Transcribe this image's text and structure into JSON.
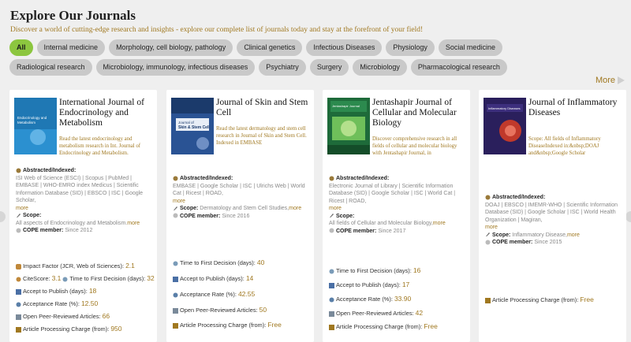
{
  "header": {
    "title": "Explore Our Journals",
    "subtitle": "Discover a world of cutting-edge research and insights - explore our complete list of journals today and stay at the forefront of your field!"
  },
  "filters": [
    "All",
    "Internal medicine",
    "Morphology, cell biology, pathology",
    "Clinical genetics",
    "Infectious Diseases",
    "Physiology",
    "Social medicine",
    "Radiological research",
    "Microbiology, immunology, infectious diseases",
    "Psychiatry",
    "Surgery",
    "Microbiology",
    "Pharmacological research"
  ],
  "more_label": "More",
  "cards": [
    {
      "title": "International Journal of Endocrinology and Metabolism",
      "cover_text": "International Journal of Endocrinology and Metabolism",
      "description": "Read the latest endocrinology and metabolism research in Int. Journal of Endocrinology and Metabolism.",
      "abstracted_label": "Abstracted/Indexed:",
      "abstracted": "ISI Web of Science (ESCI) | Scopus | PubMed | EMBASE | WHO-EMRO index Medicus | Scientific Information Database (SID) | EBSCO | ISC | Google Scholar,",
      "more": "more",
      "scope_label": "Scope:",
      "scope": "All aspects of Endocrinology and Metabolism.",
      "scope_more": "more",
      "cope_label": "COPE member:",
      "cope": "Since 2012",
      "metrics": [
        {
          "label": "Impact Factor (JCR, Web of Sciences):",
          "value": "2.1"
        },
        {
          "label": "CiteScore:",
          "value": "3.1",
          "label2": "Time to First Decision (days):",
          "value2": "32"
        },
        {
          "label": "Accept to Publish (days):",
          "value": "18"
        },
        {
          "label": "Acceptance Rate (%):",
          "value": "12.50"
        },
        {
          "label": "Open Peer-Reviewed Articles:",
          "value": "66"
        },
        {
          "label": "Article Processing Charge (from):",
          "value": "950"
        }
      ]
    },
    {
      "title": "Journal of Skin and Stem Cell",
      "cover_text": "Journal of Skin & Stem Cell",
      "description": "Read the latest dermatology and stem cell research in Journal of Skin and Stem Cell. Indexed in EMBASE",
      "abstracted_label": "Abstracted/Indexed:",
      "abstracted": "EMBASE | Google Scholar | ISC | Ulrichs Web | World Cat | Ricest | ROAD,",
      "more": "more",
      "scope_label": "Scope:",
      "scope": "Dermatology and Stem Cell Studies,",
      "scope_more": "more",
      "cope_label": "COPE member:",
      "cope": "Since 2016",
      "metrics": [
        {
          "label": "Time to First Decision (days):",
          "value": "40"
        },
        {
          "label": "Accept to Publish (days):",
          "value": "14"
        },
        {
          "label": "Acceptance Rate (%):",
          "value": "42.55"
        },
        {
          "label": "Open Peer-Reviewed Articles:",
          "value": "50"
        },
        {
          "label": "Article Processing Charge (from):",
          "value": "Free"
        }
      ]
    },
    {
      "title": "Jentashapir Journal of Cellular and Molecular Biology",
      "cover_text": "Jentashapir Journal of Cellular and Molecular Biology",
      "description": "Discover comprehensive research in all fields of cellular and molecular biology with Jentashapir Journal, in",
      "abstracted_label": "Abstracted/Indexed:",
      "abstracted": "Electronic Journal of Library | Scientific Information Database (SID) | Google Scholar | ISC | World Cat | Ricest | ROAD,",
      "more": "more",
      "scope_label": "Scope:",
      "scope": "All fields of Cellular and Molecular Biology,",
      "scope_more": "more",
      "cope_label": "COPE member:",
      "cope": "Since 2017",
      "metrics": [
        {
          "label": "Time to First Decision (days):",
          "value": "16"
        },
        {
          "label": "Accept to Publish (days):",
          "value": "17"
        },
        {
          "label": "Acceptance Rate (%):",
          "value": "33.90"
        },
        {
          "label": "Open Peer-Reviewed Articles:",
          "value": "42"
        },
        {
          "label": "Article Processing Charge (from):",
          "value": "Free"
        }
      ]
    },
    {
      "title": "Journal of Inflammatory Diseases",
      "cover_text": "Journal of Inflammatory Diseases",
      "description": "Scope: All fields of Inflammatory DiseaseIndexed in:&nbsp;DOAJ and&nbsp;Google Scholar",
      "abstracted_label": "Abstracted/Indexed:",
      "abstracted": "DOAJ | EBSCO | IMEMR-WHO | Scientific Information Database (SID) | Google Scholar | ISC | World Health Organization | Magiran,",
      "more": "more",
      "scope_label": "Scope:",
      "scope": "Inflammatory Disease,",
      "scope_more": "more",
      "cope_label": "COPE member:",
      "cope": "Since 2015",
      "metrics": [
        {
          "label": "Article Processing Charge (from):",
          "value": "Free"
        }
      ]
    }
  ]
}
